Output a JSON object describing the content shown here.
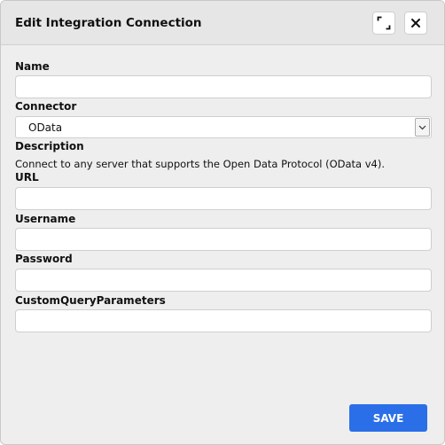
{
  "dialog": {
    "title": "Edit Integration Connection",
    "expand_icon": "expand-icon",
    "close_icon": "close-icon"
  },
  "form": {
    "name_label": "Name",
    "name_value": "",
    "connector_label": "Connector",
    "connector_value": "OData",
    "description_label": "Description",
    "description_text": "Connect to any server that supports the Open Data Protocol (OData v4).",
    "url_label": "URL",
    "url_value": "",
    "username_label": "Username",
    "username_value": "",
    "password_label": "Password",
    "password_value": "",
    "custom_query_label": "CustomQueryParameters",
    "custom_query_value": ""
  },
  "footer": {
    "save_label": "SAVE"
  },
  "colors": {
    "primary": "#2b6fe8",
    "dialog_bg": "#eeeeee",
    "header_bg": "#e6e6e6"
  }
}
